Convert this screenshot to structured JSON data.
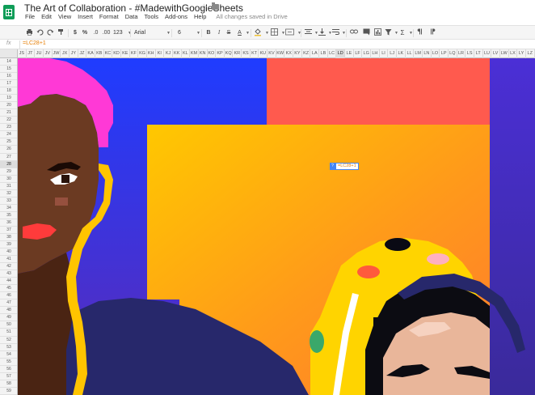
{
  "title_bar": {
    "doc_title": "The Art of Collaboration - #MadewithGoogleSheets",
    "menu": [
      "File",
      "Edit",
      "View",
      "Insert",
      "Format",
      "Data",
      "Tools",
      "Add-ons",
      "Help"
    ],
    "save_status": "All changes saved in Drive"
  },
  "toolbar": {
    "currency": "$",
    "percent": "%",
    "decimal_less": ".0",
    "decimal_more": ".00",
    "number_format": "123",
    "font": "Arial",
    "font_size": "6",
    "bold": "B",
    "italic": "I",
    "strike": "S",
    "text_color": "A",
    "sum": "Σ"
  },
  "formula_bar": {
    "fx": "fx",
    "formula": "=LC28+1"
  },
  "columns": [
    "JS",
    "JT",
    "JU",
    "JV",
    "JW",
    "JX",
    "JY",
    "JZ",
    "KA",
    "KB",
    "KC",
    "KD",
    "KE",
    "KF",
    "KG",
    "KH",
    "KI",
    "KJ",
    "KK",
    "KL",
    "KM",
    "KN",
    "KO",
    "KP",
    "KQ",
    "KR",
    "KS",
    "KT",
    "KU",
    "KV",
    "KW",
    "KX",
    "KY",
    "KZ",
    "LA",
    "LB",
    "LC",
    "LD",
    "LE",
    "LF",
    "LG",
    "LH",
    "LI",
    "LJ",
    "LK",
    "LL",
    "LM",
    "LN",
    "LO",
    "LP",
    "LQ",
    "LR",
    "LS",
    "LT",
    "LU",
    "LV",
    "LW",
    "LX",
    "LY",
    "LZ"
  ],
  "active_column": "LD",
  "rows": [
    "14",
    "15",
    "16",
    "17",
    "18",
    "19",
    "20",
    "21",
    "22",
    "23",
    "24",
    "25",
    "26",
    "27",
    "28",
    "29",
    "30",
    "31",
    "32",
    "33",
    "34",
    "35",
    "36",
    "37",
    "38",
    "39",
    "40",
    "41",
    "42",
    "43",
    "44",
    "45",
    "46",
    "47",
    "48",
    "49",
    "50",
    "51",
    "52",
    "53",
    "54",
    "55",
    "56",
    "57",
    "58",
    "59"
  ],
  "active_row": "28",
  "cell_editor": {
    "badge": "?",
    "value": "=LC28+1"
  },
  "colors": {
    "header_bg": "#f3f3f3",
    "accent_blue": "#4285f4",
    "formula_orange": "#e67c00",
    "sheets_green": "#0f9d58"
  }
}
